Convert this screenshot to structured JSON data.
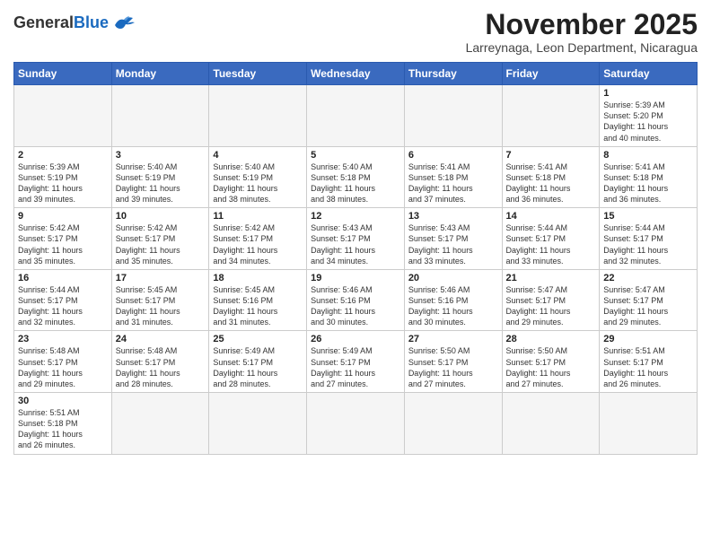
{
  "header": {
    "logo_general": "General",
    "logo_blue": "Blue",
    "month_title": "November 2025",
    "subtitle": "Larreynaga, Leon Department, Nicaragua"
  },
  "weekdays": [
    "Sunday",
    "Monday",
    "Tuesday",
    "Wednesday",
    "Thursday",
    "Friday",
    "Saturday"
  ],
  "days": [
    {
      "number": "",
      "info": ""
    },
    {
      "number": "",
      "info": ""
    },
    {
      "number": "",
      "info": ""
    },
    {
      "number": "",
      "info": ""
    },
    {
      "number": "",
      "info": ""
    },
    {
      "number": "",
      "info": ""
    },
    {
      "number": "1",
      "info": "Sunrise: 5:39 AM\nSunset: 5:20 PM\nDaylight: 11 hours\nand 40 minutes."
    },
    {
      "number": "2",
      "info": "Sunrise: 5:39 AM\nSunset: 5:19 PM\nDaylight: 11 hours\nand 39 minutes."
    },
    {
      "number": "3",
      "info": "Sunrise: 5:40 AM\nSunset: 5:19 PM\nDaylight: 11 hours\nand 39 minutes."
    },
    {
      "number": "4",
      "info": "Sunrise: 5:40 AM\nSunset: 5:19 PM\nDaylight: 11 hours\nand 38 minutes."
    },
    {
      "number": "5",
      "info": "Sunrise: 5:40 AM\nSunset: 5:18 PM\nDaylight: 11 hours\nand 38 minutes."
    },
    {
      "number": "6",
      "info": "Sunrise: 5:41 AM\nSunset: 5:18 PM\nDaylight: 11 hours\nand 37 minutes."
    },
    {
      "number": "7",
      "info": "Sunrise: 5:41 AM\nSunset: 5:18 PM\nDaylight: 11 hours\nand 36 minutes."
    },
    {
      "number": "8",
      "info": "Sunrise: 5:41 AM\nSunset: 5:18 PM\nDaylight: 11 hours\nand 36 minutes."
    },
    {
      "number": "9",
      "info": "Sunrise: 5:42 AM\nSunset: 5:17 PM\nDaylight: 11 hours\nand 35 minutes."
    },
    {
      "number": "10",
      "info": "Sunrise: 5:42 AM\nSunset: 5:17 PM\nDaylight: 11 hours\nand 35 minutes."
    },
    {
      "number": "11",
      "info": "Sunrise: 5:42 AM\nSunset: 5:17 PM\nDaylight: 11 hours\nand 34 minutes."
    },
    {
      "number": "12",
      "info": "Sunrise: 5:43 AM\nSunset: 5:17 PM\nDaylight: 11 hours\nand 34 minutes."
    },
    {
      "number": "13",
      "info": "Sunrise: 5:43 AM\nSunset: 5:17 PM\nDaylight: 11 hours\nand 33 minutes."
    },
    {
      "number": "14",
      "info": "Sunrise: 5:44 AM\nSunset: 5:17 PM\nDaylight: 11 hours\nand 33 minutes."
    },
    {
      "number": "15",
      "info": "Sunrise: 5:44 AM\nSunset: 5:17 PM\nDaylight: 11 hours\nand 32 minutes."
    },
    {
      "number": "16",
      "info": "Sunrise: 5:44 AM\nSunset: 5:17 PM\nDaylight: 11 hours\nand 32 minutes."
    },
    {
      "number": "17",
      "info": "Sunrise: 5:45 AM\nSunset: 5:17 PM\nDaylight: 11 hours\nand 31 minutes."
    },
    {
      "number": "18",
      "info": "Sunrise: 5:45 AM\nSunset: 5:16 PM\nDaylight: 11 hours\nand 31 minutes."
    },
    {
      "number": "19",
      "info": "Sunrise: 5:46 AM\nSunset: 5:16 PM\nDaylight: 11 hours\nand 30 minutes."
    },
    {
      "number": "20",
      "info": "Sunrise: 5:46 AM\nSunset: 5:16 PM\nDaylight: 11 hours\nand 30 minutes."
    },
    {
      "number": "21",
      "info": "Sunrise: 5:47 AM\nSunset: 5:17 PM\nDaylight: 11 hours\nand 29 minutes."
    },
    {
      "number": "22",
      "info": "Sunrise: 5:47 AM\nSunset: 5:17 PM\nDaylight: 11 hours\nand 29 minutes."
    },
    {
      "number": "23",
      "info": "Sunrise: 5:48 AM\nSunset: 5:17 PM\nDaylight: 11 hours\nand 29 minutes."
    },
    {
      "number": "24",
      "info": "Sunrise: 5:48 AM\nSunset: 5:17 PM\nDaylight: 11 hours\nand 28 minutes."
    },
    {
      "number": "25",
      "info": "Sunrise: 5:49 AM\nSunset: 5:17 PM\nDaylight: 11 hours\nand 28 minutes."
    },
    {
      "number": "26",
      "info": "Sunrise: 5:49 AM\nSunset: 5:17 PM\nDaylight: 11 hours\nand 27 minutes."
    },
    {
      "number": "27",
      "info": "Sunrise: 5:50 AM\nSunset: 5:17 PM\nDaylight: 11 hours\nand 27 minutes."
    },
    {
      "number": "28",
      "info": "Sunrise: 5:50 AM\nSunset: 5:17 PM\nDaylight: 11 hours\nand 27 minutes."
    },
    {
      "number": "29",
      "info": "Sunrise: 5:51 AM\nSunset: 5:17 PM\nDaylight: 11 hours\nand 26 minutes."
    },
    {
      "number": "30",
      "info": "Sunrise: 5:51 AM\nSunset: 5:18 PM\nDaylight: 11 hours\nand 26 minutes."
    },
    {
      "number": "",
      "info": ""
    },
    {
      "number": "",
      "info": ""
    },
    {
      "number": "",
      "info": ""
    },
    {
      "number": "",
      "info": ""
    },
    {
      "number": "",
      "info": ""
    },
    {
      "number": "",
      "info": ""
    }
  ]
}
